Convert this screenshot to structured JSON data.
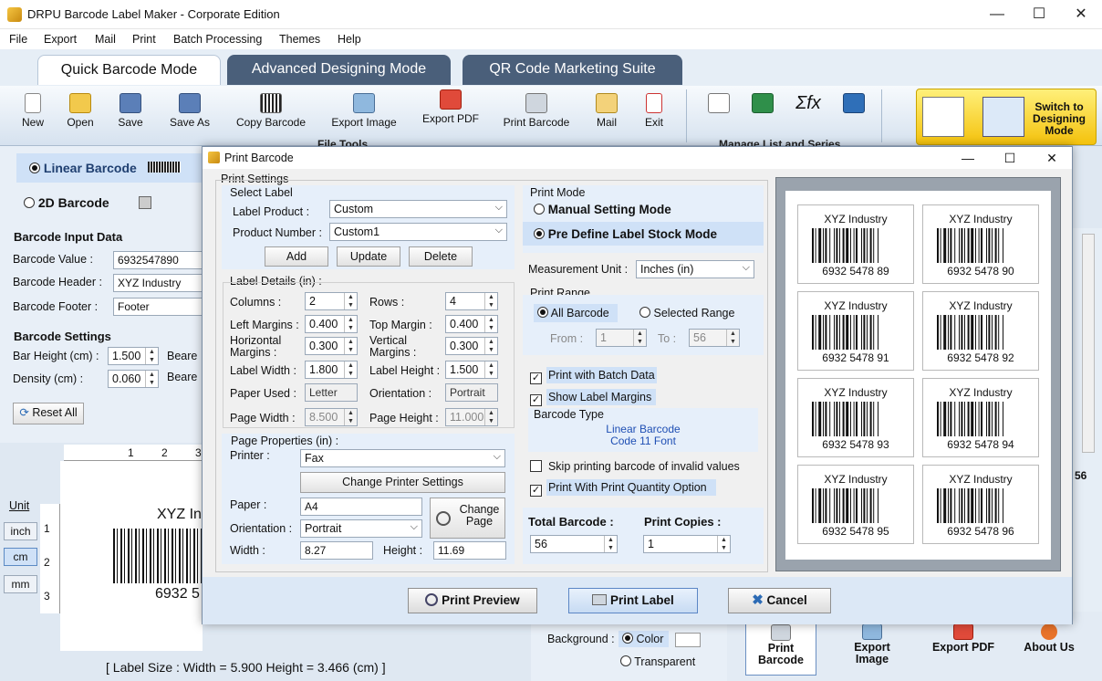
{
  "window": {
    "title": "DRPU Barcode Label Maker - Corporate Edition",
    "min": "—",
    "max": "☐",
    "close": "✕"
  },
  "menu": [
    "File",
    "Export",
    "Mail",
    "Print",
    "Batch Processing",
    "Themes",
    "Help"
  ],
  "tabs": [
    "Quick Barcode Mode",
    "Advanced Designing Mode",
    "QR Code Marketing Suite"
  ],
  "toolbar": {
    "file_tools": [
      "New",
      "Open",
      "Save",
      "Save As",
      "Copy Barcode",
      "Export Image",
      "Export PDF",
      "Print Barcode",
      "Mail",
      "Exit"
    ],
    "file_tools_group": "File Tools",
    "manage_group": "Manage List and Series",
    "fx_symbol": "Σfx",
    "switch": "Switch to Designing Mode"
  },
  "left": {
    "linear": "Linear Barcode",
    "twod": "2D Barcode",
    "input_title": "Barcode Input Data",
    "value_label": "Barcode Value :",
    "value": "6932547890",
    "header_label": "Barcode Header :",
    "header": "XYZ Industry",
    "footer_label": "Barcode Footer :",
    "footer": "Footer",
    "settings_title": "Barcode Settings",
    "bar_height_label": "Bar Height (cm) :",
    "bar_height": "1.500",
    "bearer1": "Beare",
    "density_label": "Density (cm) :",
    "density": "0.060",
    "bearer2": "Beare",
    "reset": "Reset All"
  },
  "canvas": {
    "unit_title": "Unit",
    "units": [
      "inch",
      "cm",
      "mm"
    ],
    "ruler_top": [
      "1",
      "2",
      "3"
    ],
    "ruler_left": [
      "1",
      "2",
      "3"
    ],
    "label_header": "XYZ In",
    "label_number": "6932 5",
    "status": "[ Label Size : Width = 5.900  Height = 3.466 (cm) ]"
  },
  "background": {
    "label": "Background :",
    "color": "Color",
    "transparent": "Transparent"
  },
  "bottom_buttons": [
    "Print Barcode",
    "Export Image",
    "Export PDF",
    "About Us"
  ],
  "right_edge_text": "56",
  "dialog": {
    "title": "Print Barcode",
    "print_settings": "Print Settings",
    "select_label": "Select Label",
    "label_product_label": "Label Product :",
    "label_product": "Custom",
    "product_number_label": "Product Number :",
    "product_number": "Custom1",
    "add": "Add",
    "update": "Update",
    "delete": "Delete",
    "label_details": "Label Details (in) :",
    "columns_label": "Columns :",
    "columns": "2",
    "rows_label": "Rows :",
    "rows": "4",
    "left_margins_label": "Left Margins :",
    "left_margins": "0.400",
    "top_margin_label": "Top Margin :",
    "top_margin": "0.400",
    "h_margins_label1": "Horizontal",
    "h_margins_label2": "Margins :",
    "h_margins": "0.300",
    "v_margins_label1": "Vertical",
    "v_margins_label2": "Margins :",
    "v_margins": "0.300",
    "label_width_label": "Label Width :",
    "label_width": "1.800",
    "label_height_label": "Label Height :",
    "label_height": "1.500",
    "paper_used_label": "Paper Used :",
    "paper_used": "Letter",
    "orientation_label": "Orientation :",
    "orientation": "Portrait",
    "page_width_label": "Page Width :",
    "page_width": "8.500",
    "page_height_label": "Page Height :",
    "page_height": "11.000",
    "page_props": "Page Properties (in) :",
    "printer_label": "Printer :",
    "printer": "Fax",
    "change_printer": "Change Printer Settings",
    "paper_label": "Paper :",
    "paper": "A4",
    "orientation2_label": "Orientation :",
    "orientation2": "Portrait",
    "change_page": "Change Page",
    "width_label": "Width :",
    "width": "8.27",
    "height_label": "Height :",
    "height": "11.69",
    "print_mode": "Print Mode",
    "manual_mode": "Manual Setting Mode",
    "predefine_mode": "Pre Define Label Stock Mode",
    "measurement_label": "Measurement Unit :",
    "measurement": "Inches (in)",
    "print_range": "Print Range",
    "all_barcode": "All Barcode",
    "selected_range": "Selected Range",
    "from_label": "From :",
    "from": "1",
    "to_label": "To :",
    "to": "56",
    "batch": "Print with Batch Data",
    "show_margins": "Show Label Margins",
    "barcode_type_title": "Barcode Type",
    "barcode_type1": "Linear Barcode",
    "barcode_type2": "Code 11 Font",
    "skip_invalid": "Skip printing barcode of invalid values",
    "print_qty": "Print With Print Quantity Option",
    "total_label": "Total Barcode :",
    "total": "56",
    "copies_label": "Print Copies :",
    "copies": "1",
    "preview_btn": "Print Preview",
    "print_btn": "Print Label",
    "cancel_btn": "Cancel",
    "preview_labels": [
      {
        "header": "XYZ Industry",
        "number": "6932 5478 89"
      },
      {
        "header": "XYZ Industry",
        "number": "6932 5478 90"
      },
      {
        "header": "XYZ Industry",
        "number": "6932 5478 91"
      },
      {
        "header": "XYZ Industry",
        "number": "6932 5478 92"
      },
      {
        "header": "XYZ Industry",
        "number": "6932 5478 93"
      },
      {
        "header": "XYZ Industry",
        "number": "6932 5478 94"
      },
      {
        "header": "XYZ Industry",
        "number": "6932 5478 95"
      },
      {
        "header": "XYZ Industry",
        "number": "6932 5478 96"
      }
    ]
  }
}
